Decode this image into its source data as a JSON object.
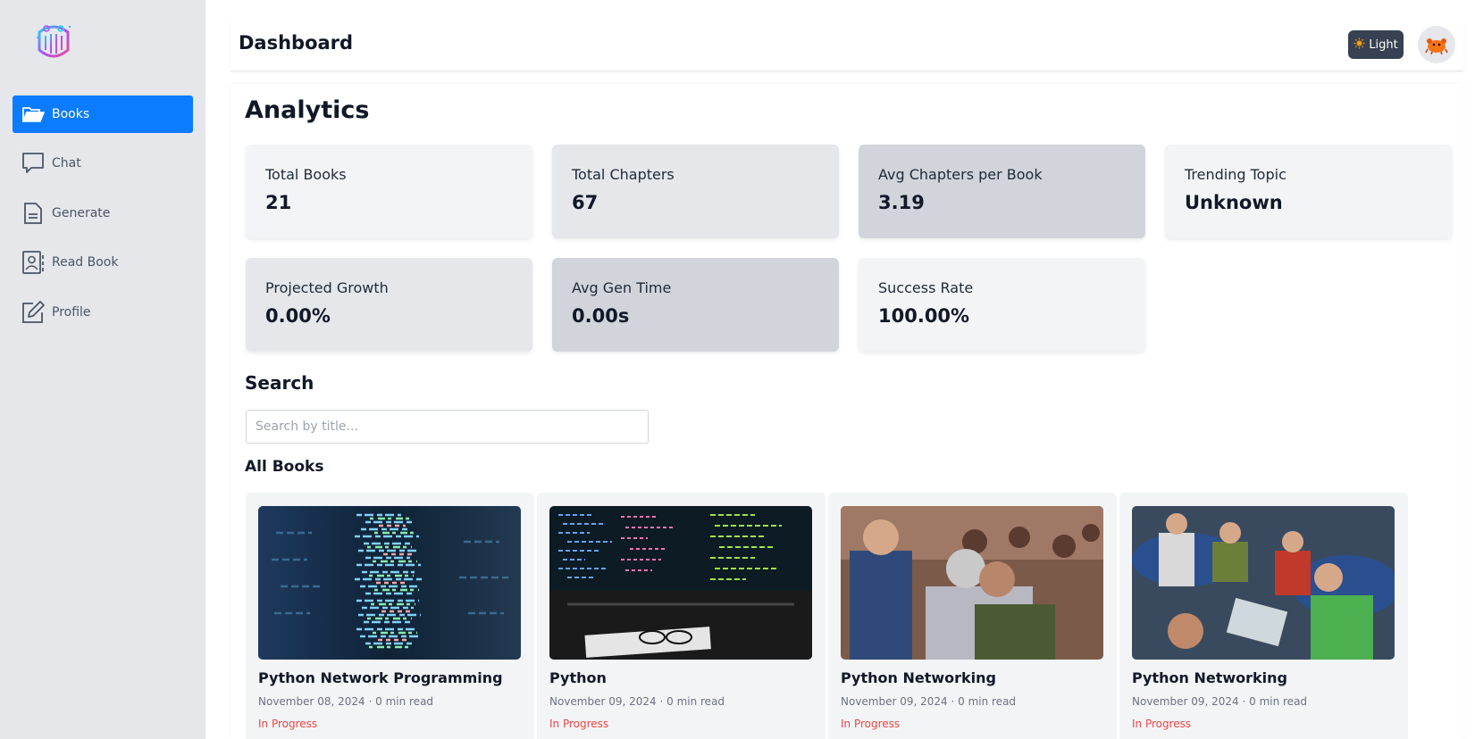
{
  "app": {
    "page_title": "Dashboard",
    "theme_label": "Light"
  },
  "sidebar": {
    "items": [
      {
        "label": "Books",
        "icon": "folder-open-icon",
        "active": true
      },
      {
        "label": "Chat",
        "icon": "chat-icon",
        "active": false
      },
      {
        "label": "Generate",
        "icon": "document-icon",
        "active": false
      },
      {
        "label": "Read Book",
        "icon": "contact-book-icon",
        "active": false
      },
      {
        "label": "Profile",
        "icon": "edit-icon",
        "active": false
      }
    ]
  },
  "analytics": {
    "title": "Analytics",
    "stats": [
      {
        "label": "Total Books",
        "value": "21"
      },
      {
        "label": "Total Chapters",
        "value": "67"
      },
      {
        "label": "Avg Chapters per Book",
        "value": "3.19"
      },
      {
        "label": "Trending Topic",
        "value": "Unknown"
      },
      {
        "label": "Projected Growth",
        "value": "0.00%"
      },
      {
        "label": "Avg Gen Time",
        "value": "0.00s"
      },
      {
        "label": "Success Rate",
        "value": "100.00%"
      }
    ]
  },
  "search": {
    "title": "Search",
    "placeholder": "Search by title..."
  },
  "books": {
    "title": "All Books",
    "items": [
      {
        "title": "Python Network Programming",
        "meta": "November 08, 2024 · 0 min read",
        "status": "In Progress"
      },
      {
        "title": "Python",
        "meta": "November 09, 2024 · 0 min read",
        "status": "In Progress"
      },
      {
        "title": "Python Networking",
        "meta": "November 09, 2024 · 0 min read",
        "status": "In Progress"
      },
      {
        "title": "Python Networking",
        "meta": "November 09, 2024 · 0 min read",
        "status": "In Progress"
      }
    ]
  },
  "colors": {
    "accent": "#0b7bff",
    "status_in_progress": "#ef4444",
    "sidebar_bg": "#e5e7eb"
  }
}
